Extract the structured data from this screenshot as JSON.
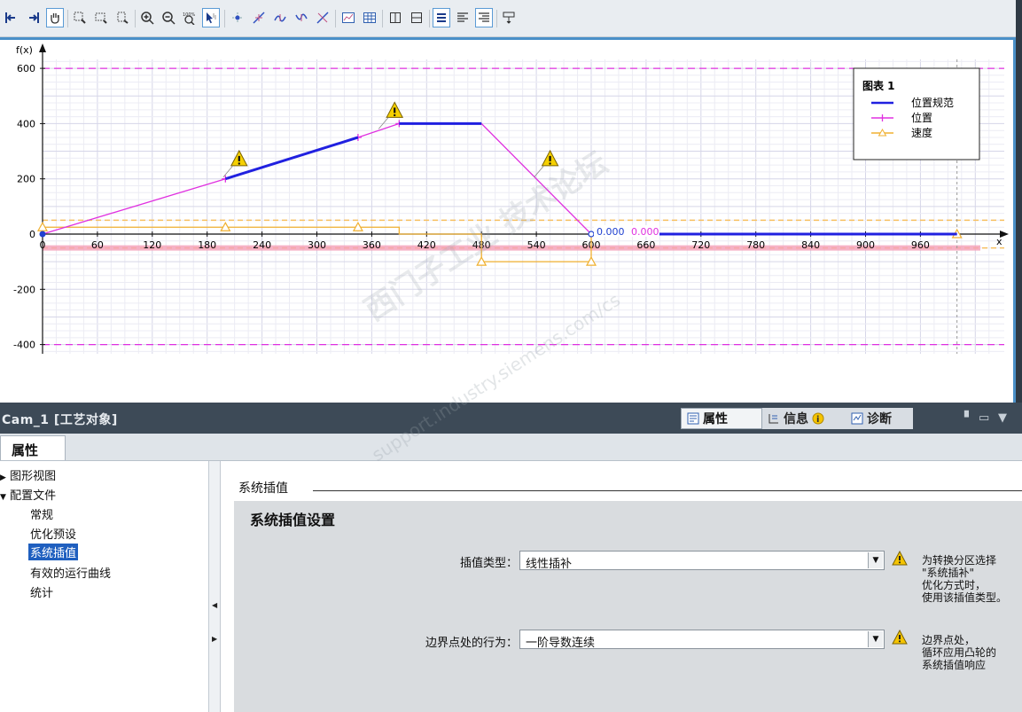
{
  "toolbar": {
    "buttons": [
      {
        "name": "move-left-icon"
      },
      {
        "name": "move-right-icon"
      },
      {
        "name": "pan-hand-icon"
      },
      {
        "name": "zoom-region-icon"
      },
      {
        "name": "zoom-horizontal-icon"
      },
      {
        "name": "zoom-vertical-icon"
      },
      {
        "name": "zoom-in-icon"
      },
      {
        "name": "zoom-out-icon"
      },
      {
        "name": "zoom-100-icon"
      },
      {
        "name": "select-pointer-icon"
      },
      {
        "name": "insert-point-icon"
      },
      {
        "name": "insert-segment-icon"
      },
      {
        "name": "curve-segment-icon"
      },
      {
        "name": "curve-segment2-icon"
      },
      {
        "name": "delete-segment-icon"
      },
      {
        "name": "chart-view-icon"
      },
      {
        "name": "table-view-icon"
      },
      {
        "name": "split-vertical-icon"
      },
      {
        "name": "split-horizontal-icon"
      },
      {
        "name": "legend-list-icon"
      },
      {
        "name": "align-left-icon"
      },
      {
        "name": "align-right-icon"
      },
      {
        "name": "tooltip-icon"
      }
    ],
    "zoom_100_text": "100%"
  },
  "chart_data": {
    "type": "line",
    "ylabel": "f(x)",
    "xlabel": "x",
    "x_ticks": [
      0,
      60,
      120,
      180,
      240,
      300,
      360,
      420,
      480,
      540,
      600,
      660,
      720,
      780,
      840,
      900,
      960
    ],
    "y_ticks": [
      600,
      400,
      200,
      0,
      -200,
      -400
    ],
    "xlim": [
      0,
      1000
    ],
    "ylim": [
      -420,
      620
    ],
    "limit_lines": [
      600,
      -400
    ],
    "legend": {
      "title": "图表 1",
      "placement": "top-right",
      "entries": [
        {
          "label": "位置规范",
          "color": "#2020e0"
        },
        {
          "label": "位置",
          "color": "#e030e0"
        },
        {
          "label": "速度",
          "color": "#f0b030"
        }
      ]
    },
    "series": [
      {
        "name": "位置规范",
        "color": "#2020e0",
        "segments": [
          [
            [
              200,
              200
            ],
            [
              345,
              350
            ]
          ],
          [
            [
              390,
              400
            ],
            [
              480,
              400
            ]
          ],
          [
            [
              600,
              0
            ],
            [
              1000,
              0
            ]
          ]
        ]
      },
      {
        "name": "位置",
        "color": "#e030e0",
        "points": [
          [
            0,
            0
          ],
          [
            200,
            200
          ],
          [
            345,
            350
          ],
          [
            390,
            400
          ],
          [
            480,
            400
          ],
          [
            600,
            0
          ],
          [
            1000,
            0
          ]
        ],
        "markers": [
          [
            200,
            200
          ],
          [
            345,
            350
          ],
          [
            390,
            400
          ]
        ]
      },
      {
        "name": "速度",
        "color": "#f0b030",
        "points": [
          [
            0,
            0
          ],
          [
            0,
            25
          ],
          [
            200,
            25
          ],
          [
            345,
            25
          ],
          [
            390,
            25
          ],
          [
            390,
            0
          ],
          [
            480,
            0
          ],
          [
            480,
            -100
          ],
          [
            600,
            -100
          ],
          [
            600,
            0
          ],
          [
            1000,
            0
          ]
        ],
        "markers": [
          [
            0,
            25
          ],
          [
            200,
            25
          ],
          [
            345,
            25
          ],
          [
            480,
            -100
          ],
          [
            600,
            -100
          ],
          [
            1000,
            0
          ]
        ],
        "limit_band": [
          50,
          -50
        ]
      }
    ],
    "warnings": [
      [
        215,
        270
      ],
      [
        385,
        445
      ],
      [
        555,
        270
      ]
    ],
    "value_labels": [
      {
        "x": 600,
        "text": "0.000"
      },
      {
        "x": 640,
        "text": "0.000"
      }
    ]
  },
  "inspector": {
    "title": "Cam_1 [工艺对象]",
    "tabs": [
      {
        "label": "属性",
        "icon": "properties-icon"
      },
      {
        "label": "信息",
        "icon": "info-icon"
      },
      {
        "label": "诊断",
        "icon": "diagnostics-icon"
      }
    ],
    "subtab": "属性",
    "nav": [
      {
        "label": "图形视图",
        "level": 0,
        "expander": "▶"
      },
      {
        "label": "配置文件",
        "level": 0,
        "expander": "▼"
      },
      {
        "label": "常规",
        "level": 1
      },
      {
        "label": "优化预设",
        "level": 1
      },
      {
        "label": "系统插值",
        "level": 1,
        "selected": true
      },
      {
        "label": "有效的运行曲线",
        "level": 1
      },
      {
        "label": "统计",
        "level": 1
      }
    ],
    "section_title": "系统插值",
    "group_title": "系统插值设置",
    "fields": [
      {
        "label": "插值类型：",
        "value": "线性插补",
        "hint": "为转换分区选择\n\"系统插补\"\n优化方式时，\n使用该插值类型。"
      },
      {
        "label": "边界点处的行为：",
        "value": "一阶导数连续",
        "hint": "边界点处，\n循环应用凸轮的\n系统插值响应"
      }
    ]
  },
  "watermark": "西门子工业 技术论坛",
  "watermark_url": "support.industry.siemens.com/cs"
}
